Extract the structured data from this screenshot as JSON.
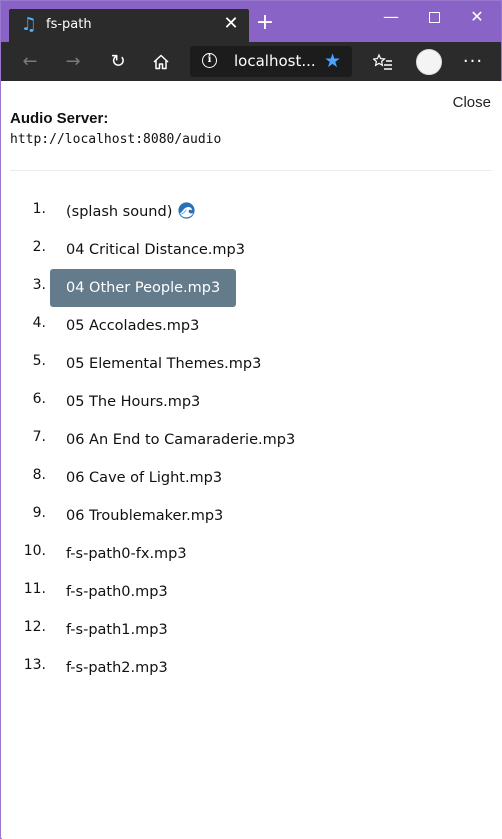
{
  "browser": {
    "tab_title": "fs-path",
    "tab_icon": "music-note-icon",
    "address": "localhost...",
    "colors": {
      "titlebar": "#8a63c6",
      "toolbar": "#2b2b2b",
      "star": "#4aa3ff"
    }
  },
  "page": {
    "close_label": "Close",
    "server_label": "Audio Server:",
    "server_url": "http://localhost:8080/audio",
    "active_color": "#637b8a",
    "tracks": [
      {
        "num": "1.",
        "name": "(splash sound)",
        "icon": "wave-icon"
      },
      {
        "num": "2.",
        "name": "04 Critical Distance.mp3"
      },
      {
        "num": "3.",
        "name": "04 Other People.mp3",
        "active": true
      },
      {
        "num": "4.",
        "name": "05 Accolades.mp3"
      },
      {
        "num": "5.",
        "name": "05 Elemental Themes.mp3"
      },
      {
        "num": "6.",
        "name": "05 The Hours.mp3"
      },
      {
        "num": "7.",
        "name": "06 An End to Camaraderie.mp3"
      },
      {
        "num": "8.",
        "name": "06 Cave of Light.mp3"
      },
      {
        "num": "9.",
        "name": "06 Troublemaker.mp3"
      },
      {
        "num": "10.",
        "name": "f-s-path0-fx.mp3"
      },
      {
        "num": "11.",
        "name": "f-s-path0.mp3"
      },
      {
        "num": "12.",
        "name": "f-s-path1.mp3"
      },
      {
        "num": "13.",
        "name": "f-s-path2.mp3"
      }
    ]
  }
}
